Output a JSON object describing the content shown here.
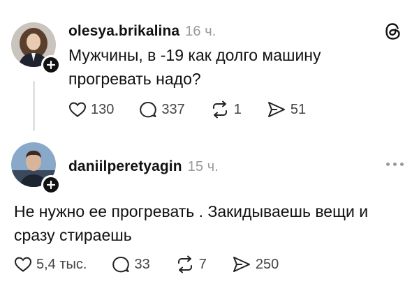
{
  "post": {
    "username": "olesya.brikalina",
    "time": "16 ч.",
    "text_line1": "Мужчины, в -19 как долго машину",
    "text_line2": "прогревать надо?",
    "likes": "130",
    "replies": "337",
    "reposts": "1",
    "shares": "51"
  },
  "reply": {
    "username": "daniilperetyagin",
    "time": "15 ч.",
    "text_line1": "Не нужно ее прогревать . Закидываешь вещи и",
    "text_line2": "сразу стираешь",
    "likes": "5,4 тыс.",
    "replies": "33",
    "reposts": "7",
    "shares": "250"
  },
  "icons": {
    "logo": "threads-logo-icon",
    "more": "more-dots-icon",
    "like": "heart-icon",
    "reply": "comment-icon",
    "repost": "repost-icon",
    "share": "send-icon",
    "follow": "plus-icon"
  }
}
